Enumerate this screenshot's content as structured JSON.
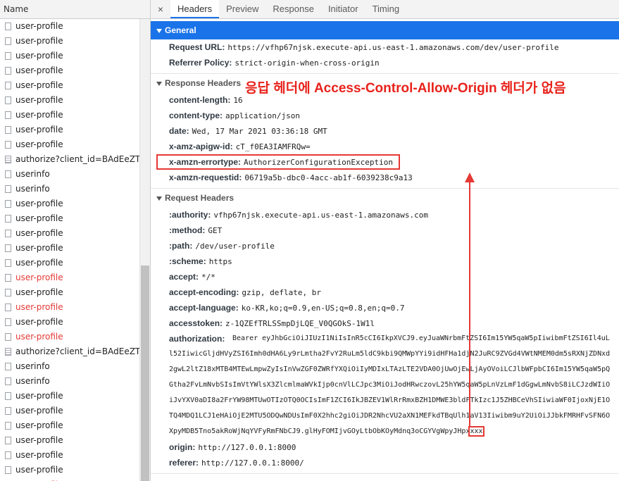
{
  "left_header": "Name",
  "rows": [
    {
      "label": "user-profile",
      "error": false,
      "icon": "blank"
    },
    {
      "label": "user-profile",
      "error": false,
      "icon": "blank"
    },
    {
      "label": "user-profile",
      "error": false,
      "icon": "blank"
    },
    {
      "label": "user-profile",
      "error": false,
      "icon": "blank"
    },
    {
      "label": "user-profile",
      "error": false,
      "icon": "blank"
    },
    {
      "label": "user-profile",
      "error": false,
      "icon": "blank"
    },
    {
      "label": "user-profile",
      "error": false,
      "icon": "blank"
    },
    {
      "label": "user-profile",
      "error": false,
      "icon": "blank"
    },
    {
      "label": "user-profile",
      "error": false,
      "icon": "blank"
    },
    {
      "label": "authorize?client_id=BAdEeZTkFl...",
      "error": false,
      "icon": "doc"
    },
    {
      "label": "userinfo",
      "error": false,
      "icon": "blank"
    },
    {
      "label": "userinfo",
      "error": false,
      "icon": "blank"
    },
    {
      "label": "user-profile",
      "error": false,
      "icon": "blank"
    },
    {
      "label": "user-profile",
      "error": false,
      "icon": "blank"
    },
    {
      "label": "user-profile",
      "error": false,
      "icon": "blank"
    },
    {
      "label": "user-profile",
      "error": false,
      "icon": "blank"
    },
    {
      "label": "user-profile",
      "error": false,
      "icon": "blank"
    },
    {
      "label": "user-profile",
      "error": true,
      "icon": "blank"
    },
    {
      "label": "user-profile",
      "error": false,
      "icon": "blank"
    },
    {
      "label": "user-profile",
      "error": true,
      "icon": "blank"
    },
    {
      "label": "user-profile",
      "error": false,
      "icon": "blank"
    },
    {
      "label": "user-profile",
      "error": true,
      "icon": "blank"
    },
    {
      "label": "authorize?client_id=BAdEeZTkFl...",
      "error": false,
      "icon": "doc"
    },
    {
      "label": "userinfo",
      "error": false,
      "icon": "blank"
    },
    {
      "label": "userinfo",
      "error": false,
      "icon": "blank"
    },
    {
      "label": "user-profile",
      "error": false,
      "icon": "blank"
    },
    {
      "label": "user-profile",
      "error": false,
      "icon": "blank"
    },
    {
      "label": "user-profile",
      "error": false,
      "icon": "blank"
    },
    {
      "label": "user-profile",
      "error": false,
      "icon": "blank"
    },
    {
      "label": "user-profile",
      "error": false,
      "icon": "blank"
    },
    {
      "label": "user-profile",
      "error": false,
      "icon": "blank"
    },
    {
      "label": "user-profile",
      "error": true,
      "icon": "blank"
    }
  ],
  "tabs": {
    "close": "×",
    "items": [
      "Headers",
      "Preview",
      "Response",
      "Initiator",
      "Timing"
    ],
    "active": 0
  },
  "general": {
    "title": "General",
    "request_url_key": "Request URL:",
    "request_url": "https://vfhp67njsk.execute-api.us-east-1.amazonaws.com/dev/user-profile",
    "referrer_key": "Referrer Policy:",
    "referrer": "strict-origin-when-cross-origin"
  },
  "response": {
    "title": "Response Headers",
    "items": [
      {
        "k": "content-length:",
        "v": "16"
      },
      {
        "k": "content-type:",
        "v": "application/json"
      },
      {
        "k": "date:",
        "v": "Wed, 17 Mar 2021 03:36:18 GMT"
      },
      {
        "k": "x-amz-apigw-id:",
        "v": "cT_f0EA3IAMFRQw="
      },
      {
        "k": "x-amzn-errortype:",
        "v": "AuthorizerConfigurationException"
      },
      {
        "k": "x-amzn-requestid:",
        "v": "06719a5b-dbc0-4acc-ab1f-6039238c9a13"
      }
    ]
  },
  "request": {
    "title": "Request Headers",
    "items": [
      {
        "k": ":authority:",
        "v": "vfhp67njsk.execute-api.us-east-1.amazonaws.com"
      },
      {
        "k": ":method:",
        "v": "GET"
      },
      {
        "k": ":path:",
        "v": "/dev/user-profile"
      },
      {
        "k": ":scheme:",
        "v": "https"
      },
      {
        "k": "accept:",
        "v": "*/*"
      },
      {
        "k": "accept-encoding:",
        "v": "gzip, deflate, br"
      },
      {
        "k": "accept-language:",
        "v": "ko-KR,ko;q=0.9,en-US;q=0.8,en;q=0.7"
      },
      {
        "k": "accesstoken:",
        "v": "z-1QZEfTRLSSmpDjLQE_V0QGOkS-1W1l"
      }
    ],
    "auth_key": "authorization:",
    "auth_value": "Bearer eyJhbGciOiJIUzI1NiIsInR5cCI6IkpXVCJ9.eyJuaWNrbmFtZSI6Im15YW5qaW5pIiwibmFtZSI6Il4uLl52IiwicGljdHVyZSI6Imh0dHA6Ly9rLmtha2FvY2RuLm5ldC9kbi9QMWpYYi9idHFHa1djN2JuRC9ZVGd4VWtNMEM0dm5sRXNjZDNxd2gwL2ltZ18xMTB4MTEwLmpwZyIsInVwZGF0ZWRfYXQiOiIyMDIxLTAzLTE2VDA0OjUwOjEwLjAyOVoiLCJlbWFpbCI6Im15YW5qaW5pQGtha2FvLmNvbSIsImVtYWlsX3ZlcmlmaWVkIjp0cnVlLCJpc3MiOiJodHRwczovL25hYW5qaW5pLnVzLmF1dGgwLmNvbS8iLCJzdWIiOiJvYXV0aDI8a2FrYW98MTUwOTIzOTQ0OCIsImF1ZCI6IkJBZEV1WlRrRmxBZH1DMWE3bldFTkIzc1J5ZHBCeVhSIiwiaWF0IjoxNjE1OTQ4MDQ1LCJ1eHAiOjE2MTU5ODQwNDUsImF0X2hhc2giOiJDR2NhcVU2aXN1MEFkdTBqUlh1aV13Iiwibm9uY2UiOiJJbkFMRHFvSFN6OXpyMDB5Tno5akRoWjNqYVFyRmFNbCJ9.glHyFOMIjvGOyLtbObKOyMdnq3oCGYVgWpyJHpx",
    "auth_tail": "xxx",
    "items_after": [
      {
        "k": "origin:",
        "v": "http://127.0.0.1:8000"
      },
      {
        "k": "referer:",
        "v": "http://127.0.0.1:8000/"
      }
    ]
  },
  "annotation": "응답 헤더에 Access-Control-Allow-Origin 헤더가 없음",
  "colors": {
    "accent": "#1a73e8",
    "annotation": "#e8221b",
    "error_row": "#e53935"
  }
}
